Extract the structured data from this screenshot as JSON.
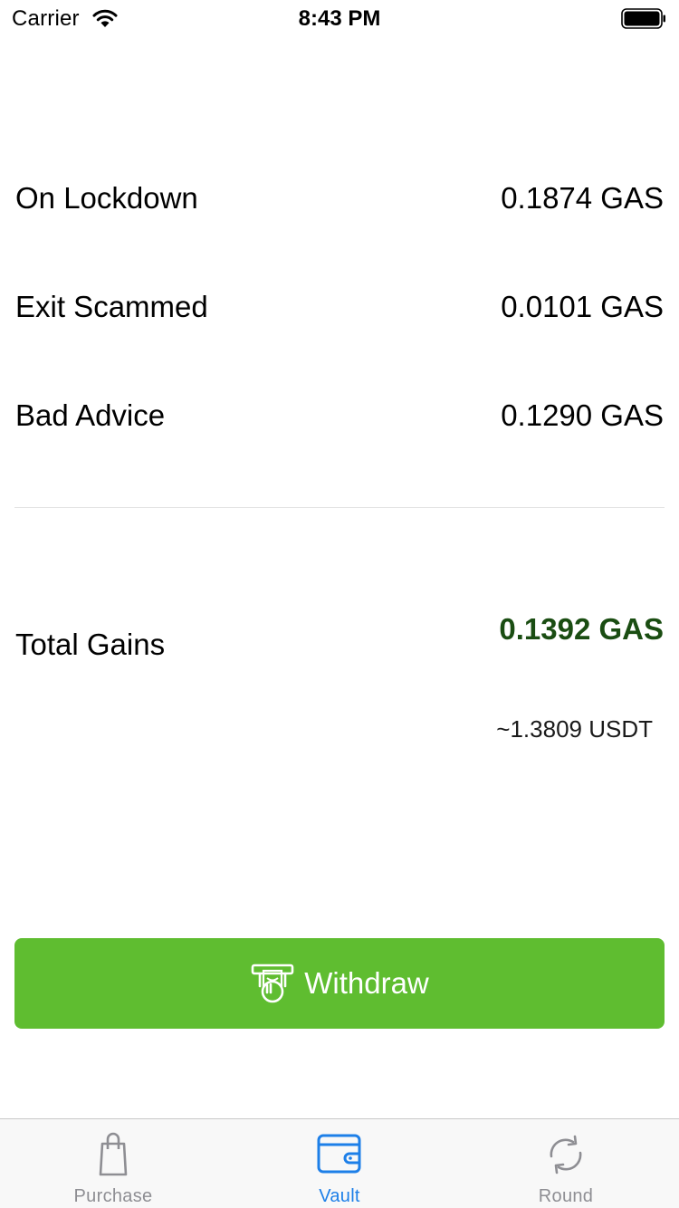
{
  "status_bar": {
    "carrier": "Carrier",
    "time": "8:43 PM"
  },
  "balances": [
    {
      "label": "On Lockdown",
      "value": "0.1874 GAS"
    },
    {
      "label": "Exit Scammed",
      "value": "0.0101 GAS"
    },
    {
      "label": "Bad Advice",
      "value": "0.1290 GAS"
    }
  ],
  "total": {
    "label": "Total Gains",
    "value": "0.1392 GAS",
    "usdt": "~1.3809 USDT",
    "value_color": "#1a4d12"
  },
  "withdraw_button": {
    "label": "Withdraw",
    "icon": "withdraw-cash-icon",
    "color": "#5fbd30"
  },
  "tab_bar": {
    "tabs": [
      {
        "label": "Purchase",
        "icon": "shopping-bag-icon",
        "active": false
      },
      {
        "label": "Vault",
        "icon": "wallet-icon",
        "active": true
      },
      {
        "label": "Round",
        "icon": "refresh-icon",
        "active": false
      }
    ],
    "active_color": "#1d7fe8",
    "inactive_color": "#8e8e93"
  }
}
